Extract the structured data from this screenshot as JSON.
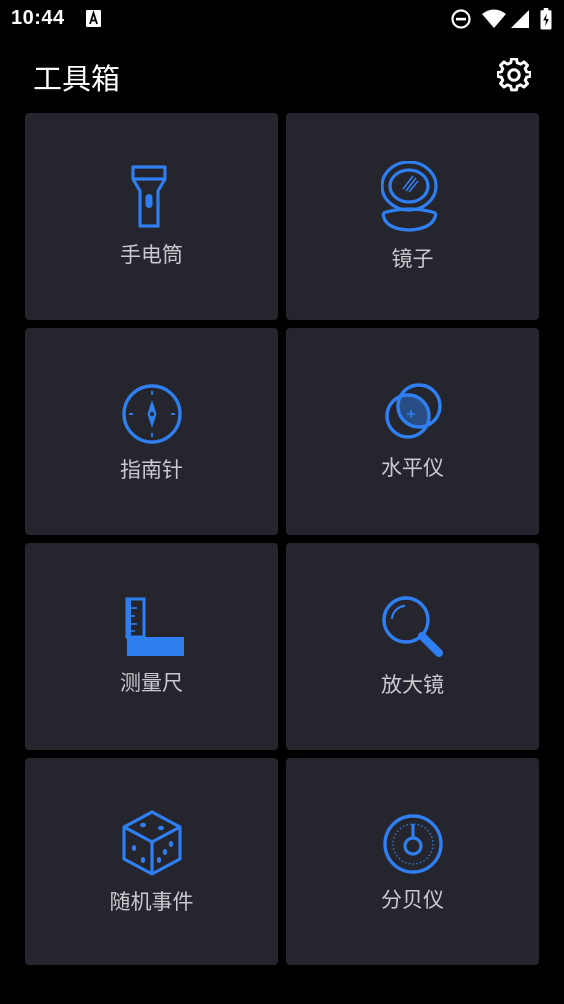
{
  "status": {
    "time": "10:44"
  },
  "header": {
    "title": "工具箱"
  },
  "colors": {
    "accent": "#2f7ff0",
    "tile_bg": "#24252d",
    "label": "#c9cacf"
  },
  "tools": [
    {
      "label": "手电筒",
      "icon": "flashlight-icon"
    },
    {
      "label": "镜子",
      "icon": "mirror-icon"
    },
    {
      "label": "指南针",
      "icon": "compass-icon"
    },
    {
      "label": "水平仪",
      "icon": "level-icon"
    },
    {
      "label": "测量尺",
      "icon": "ruler-icon"
    },
    {
      "label": "放大镜",
      "icon": "magnifier-icon"
    },
    {
      "label": "随机事件",
      "icon": "dice-icon"
    },
    {
      "label": "分贝仪",
      "icon": "decibel-icon"
    }
  ]
}
